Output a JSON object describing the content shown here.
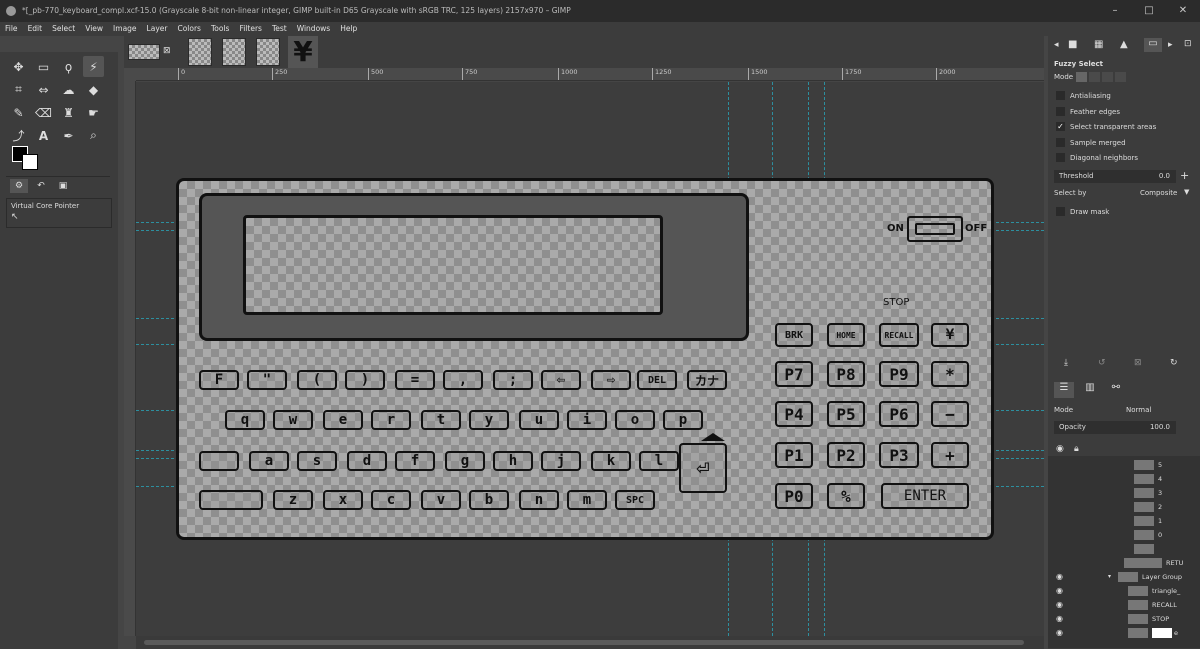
{
  "window": {
    "title": "*[_pb-770_keyboard_compl.xcf-15.0 (Grayscale 8-bit non-linear integer, GIMP built-in D65 Grayscale with sRGB TRC, 125 layers) 2157x970 – GIMP",
    "minimize": "–",
    "maximize": "□",
    "close": "✕"
  },
  "menu": [
    "File",
    "Edit",
    "Select",
    "View",
    "Image",
    "Layer",
    "Colors",
    "Tools",
    "Filters",
    "Test",
    "Windows",
    "Help"
  ],
  "ruler": {
    "ticks": [
      "0",
      "250",
      "500",
      "750",
      "1000",
      "1250",
      "1500",
      "1750",
      "2000"
    ]
  },
  "tool_options": {
    "device_panel_title": "Virtual Core Pointer",
    "title": "Fuzzy Select",
    "mode_label": "Mode",
    "antialiasing": "Antialiasing",
    "feather_edges": "Feather edges",
    "select_transparent": "Select transparent areas",
    "sample_merged": "Sample merged",
    "diagonal_neighbors": "Diagonal neighbors",
    "threshold_label": "Threshold",
    "threshold_value": "0.0",
    "select_by_label": "Select by",
    "select_by_value": "Composite",
    "draw_mask": "Draw mask"
  },
  "layers_panel": {
    "mode_label": "Mode",
    "mode_value": "Normal",
    "opacity_label": "Opacity",
    "opacity_value": "100.0",
    "layers": [
      "5",
      "4",
      "3",
      "2",
      "1",
      "0",
      "",
      "RETU",
      "Layer Group",
      "triangle_",
      "RECALL",
      "STOP",
      "e"
    ]
  },
  "calculator": {
    "on": "ON",
    "off": "OFF",
    "stop": "STOP",
    "func_row": [
      "BRK",
      "HOME",
      "RECALL",
      "¥"
    ],
    "row1": [
      "F",
      "\"",
      "(",
      ")",
      "=",
      ",",
      ";",
      "⇦",
      "⇨",
      "DEL",
      "カナ"
    ],
    "row2": [
      "q",
      "w",
      "e",
      "r",
      "t",
      "y",
      "u",
      "i",
      "o",
      "p"
    ],
    "row3": [
      "",
      "a",
      "s",
      "d",
      "f",
      "g",
      "h",
      "j",
      "k",
      "l"
    ],
    "row4": [
      "",
      "z",
      "x",
      "c",
      "v",
      "b",
      "n",
      "m",
      "SPC"
    ],
    "num_row1": [
      "P7",
      "P8",
      "P9",
      "*"
    ],
    "num_row2": [
      "P4",
      "P5",
      "P6",
      "−"
    ],
    "num_row3": [
      "P1",
      "P2",
      "P3",
      "+"
    ],
    "num_row4": [
      "P0",
      "%",
      "ENTER"
    ]
  }
}
